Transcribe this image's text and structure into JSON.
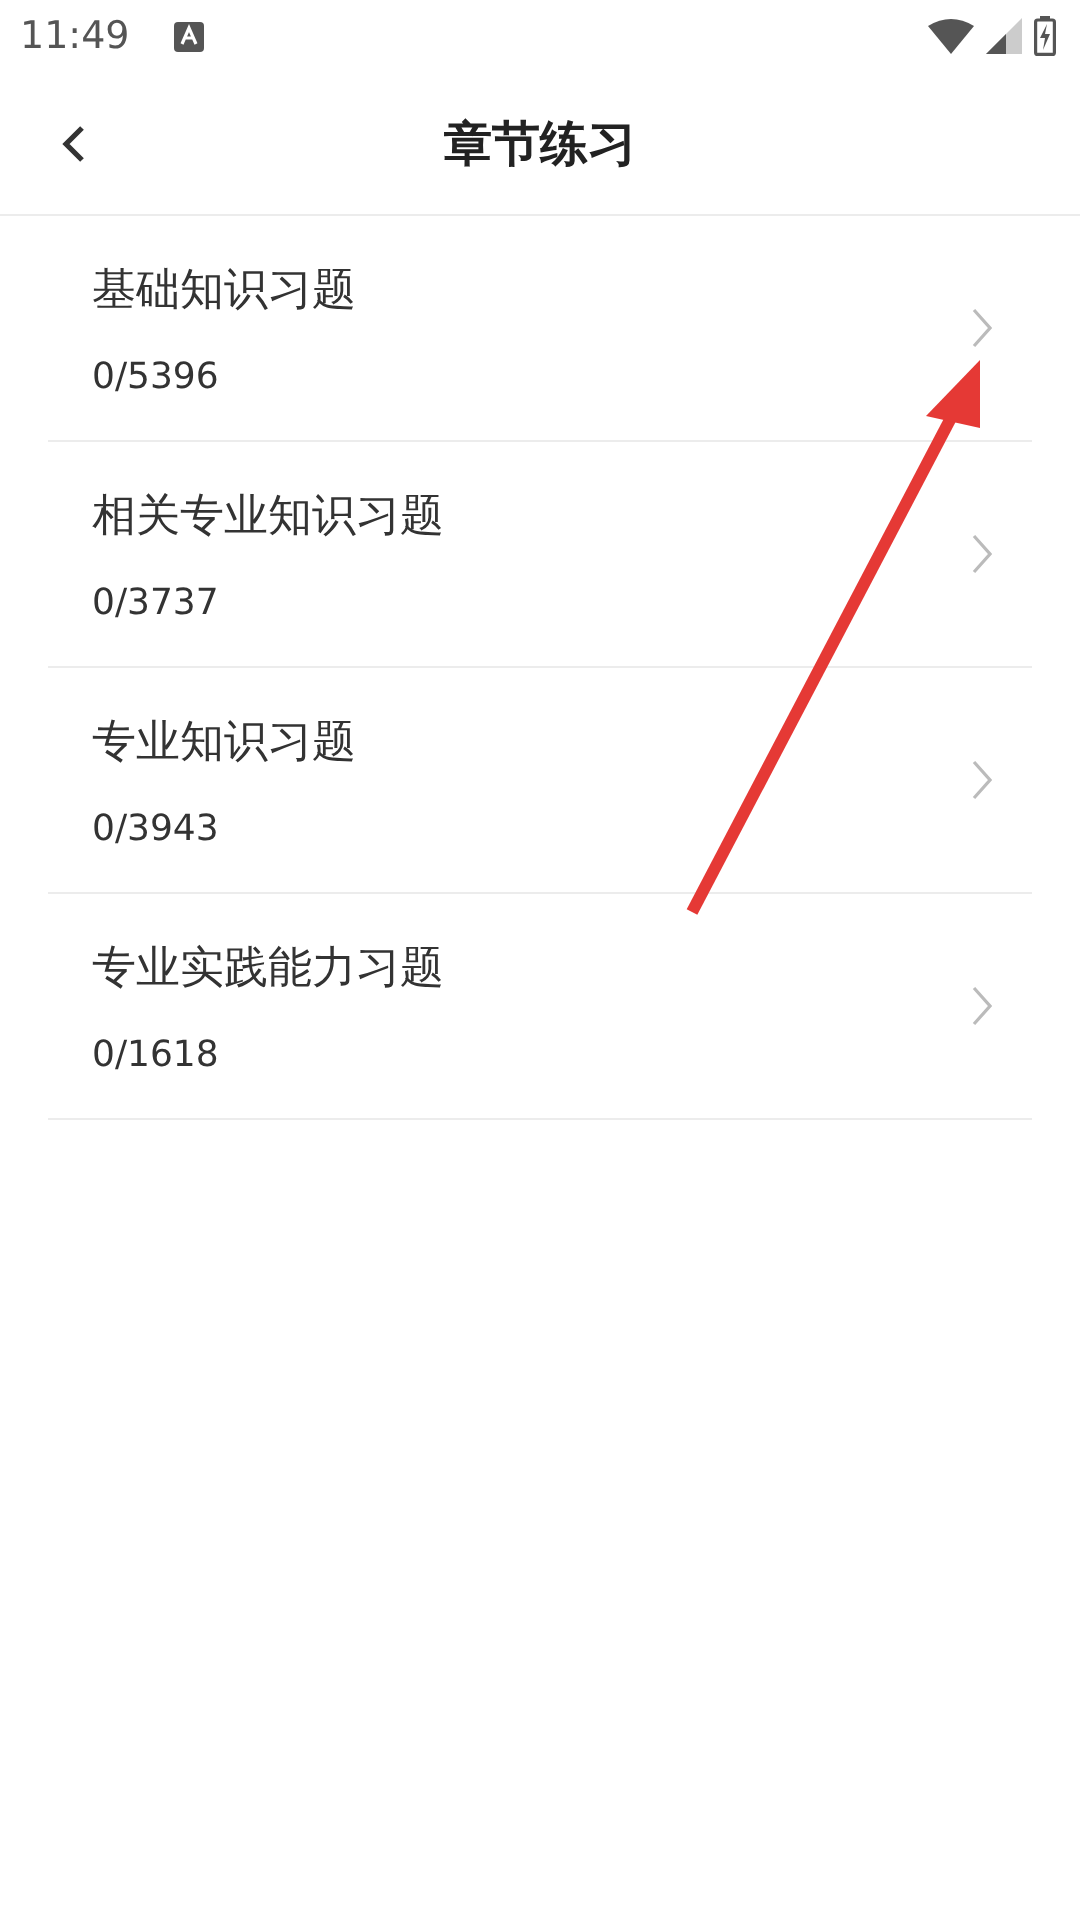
{
  "status_bar": {
    "time": "11:49"
  },
  "header": {
    "title": "章节练习"
  },
  "chapters": [
    {
      "title": "基础知识习题",
      "progress": "0/5396"
    },
    {
      "title": "相关专业知识习题",
      "progress": "0/3737"
    },
    {
      "title": "专业知识习题",
      "progress": "0/3943"
    },
    {
      "title": "专业实践能力习题",
      "progress": "0/1618"
    }
  ]
}
